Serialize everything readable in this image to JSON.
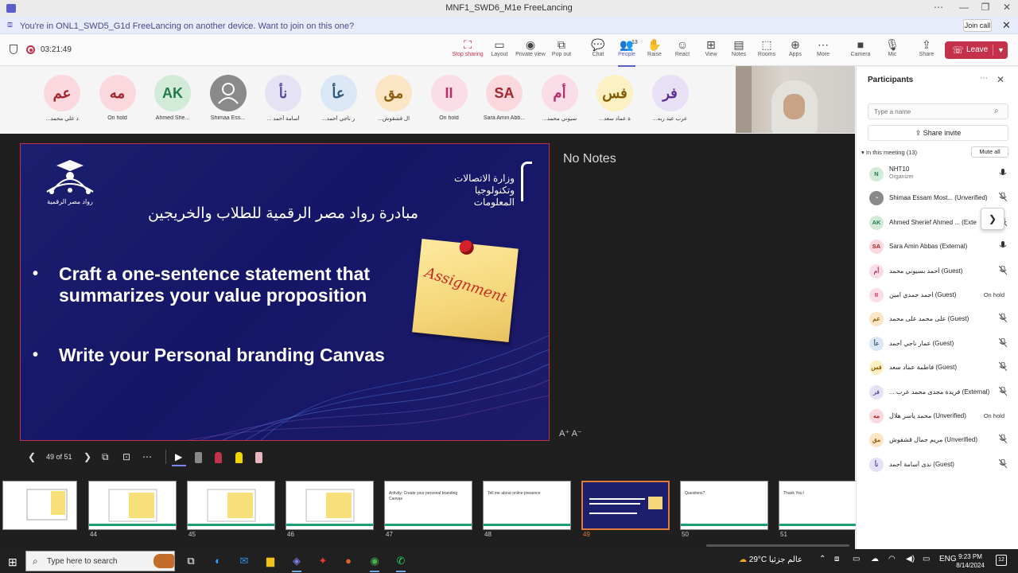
{
  "window": {
    "title": "MNF1_SWD6_M1e FreeLancing",
    "controls": [
      "⋯",
      "—",
      "❐",
      "✕"
    ]
  },
  "banner": {
    "message": "You're in ONL1_SWD5_G1d FreeLancing on another device. Want to join on this one?",
    "join_label": "Join call"
  },
  "toolbar": {
    "timer": "03:21:49",
    "buttons": [
      {
        "label": "Stop sharing",
        "icon": "stop-share-icon",
        "glyph": "⛶"
      },
      {
        "label": "Layout",
        "icon": "layout-icon",
        "glyph": "▭"
      },
      {
        "label": "Private view",
        "icon": "eye-icon",
        "glyph": "◉"
      },
      {
        "label": "Pop out",
        "icon": "pop-out-icon",
        "glyph": "⧉"
      },
      {
        "label": "Chat",
        "icon": "chat-icon",
        "glyph": "💬"
      },
      {
        "label": "People",
        "icon": "people-icon",
        "glyph": "👥",
        "badge": "13"
      },
      {
        "label": "Raise",
        "icon": "raise-hand-icon",
        "glyph": "✋"
      },
      {
        "label": "React",
        "icon": "react-icon",
        "glyph": "☺"
      },
      {
        "label": "View",
        "icon": "view-icon",
        "glyph": "⊞"
      },
      {
        "label": "Notes",
        "icon": "notes-icon",
        "glyph": "▤"
      },
      {
        "label": "Rooms",
        "icon": "rooms-icon",
        "glyph": "⬚"
      },
      {
        "label": "Apps",
        "icon": "apps-icon",
        "glyph": "⊕"
      },
      {
        "label": "More",
        "icon": "more-icon",
        "glyph": "⋯"
      },
      {
        "label": "Camera",
        "icon": "camera-icon",
        "glyph": "■"
      },
      {
        "label": "Mic",
        "icon": "mic-icon",
        "glyph": "🎙"
      },
      {
        "label": "Share",
        "icon": "share-icon",
        "glyph": "⇪"
      }
    ],
    "leave_label": "Leave"
  },
  "avatars": [
    {
      "initials": "عم",
      "name": "...د علي محمد",
      "color": "pink"
    },
    {
      "initials": "مه",
      "name": "On hold",
      "color": "pink"
    },
    {
      "initials": "AK",
      "name": "Ahmed She...",
      "color": "green"
    },
    {
      "initials": "",
      "name": "Shimaa Ess...",
      "color": "gray"
    },
    {
      "initials": "نأ",
      "name": "... أسامة أحمد",
      "color": "lav"
    },
    {
      "initials": "عأ",
      "name": "...ر ناجي أحمد",
      "color": "blue"
    },
    {
      "initials": "مق",
      "name": "...ال قشقوش",
      "color": "peach"
    },
    {
      "initials": "II",
      "name": "On hold",
      "color": "rose"
    },
    {
      "initials": "SA",
      "name": "Sara Amin Abb...",
      "color": "pink"
    },
    {
      "initials": "أم",
      "name": "...سيوني محمد",
      "color": "rose"
    },
    {
      "initials": "فس",
      "name": "...ة عماد سعد",
      "color": "yel"
    },
    {
      "initials": "فر",
      "name": "...عرب عبد ربه",
      "color": "purple"
    }
  ],
  "slide": {
    "ministry_logo": "وزارة الاتصالات وتكنولوجيا المعلومات",
    "initiative_logo": "رواد مصر الرقمية",
    "arabic_title": "مبادرة رواد مصر الرقمية للطلاب والخريجين",
    "bullets": [
      "Craft a one-sentence statement that summarizes your value proposition",
      "Write your Personal branding Canvas"
    ],
    "note_word": "Assignment"
  },
  "notes": {
    "heading": "No Notes",
    "font_controls": "A⁺  A⁻"
  },
  "slide_nav": {
    "counter": "49 of 51"
  },
  "thumbnails": [
    {
      "num": "44",
      "current": false,
      "label": ""
    },
    {
      "num": "45",
      "current": false,
      "label": ""
    },
    {
      "num": "46",
      "current": false,
      "label": ""
    },
    {
      "num": "47",
      "current": false,
      "label": "Activity: Create your personal branding Canvas"
    },
    {
      "num": "48",
      "current": false,
      "label": "Tell me about online presence"
    },
    {
      "num": "49",
      "current": true,
      "label": ""
    },
    {
      "num": "50",
      "current": false,
      "label": "Questions?"
    },
    {
      "num": "51",
      "current": false,
      "label": "Thank You !"
    }
  ],
  "participants": {
    "title": "Participants",
    "search_placeholder": "Type a name",
    "share_invite": "Share invite",
    "in_meeting": "In this meeting (13)",
    "mute_all": "Mute all",
    "list": [
      {
        "initials": "N",
        "name": "NHT10",
        "role": "Organizer",
        "status": "",
        "color": "green",
        "muted": false
      },
      {
        "initials": "",
        "name": "Shimaa Essam Most... (Unverified)",
        "role": "",
        "status": "",
        "color": "gray",
        "muted": true
      },
      {
        "initials": "AK",
        "name": "Ahmed Sherief Ahmed ... (Exte",
        "role": "",
        "status": "",
        "color": "green",
        "muted": true
      },
      {
        "initials": "SA",
        "name": "Sara Amin Abbas (External)",
        "role": "",
        "status": "",
        "color": "pink",
        "muted": false
      },
      {
        "initials": "أم",
        "name": "أحمد بسيوني محمد (Guest)",
        "role": "",
        "status": "",
        "color": "rose",
        "muted": true
      },
      {
        "initials": "II",
        "name": "احمد حمدي امين (Guest)",
        "role": "",
        "status": "On hold",
        "color": "rose",
        "muted": false
      },
      {
        "initials": "عم",
        "name": "على محمد على محمد (Guest)",
        "role": "",
        "status": "",
        "color": "peach",
        "muted": true
      },
      {
        "initials": "عأ",
        "name": "عمار ناجي أحمد (Guest)",
        "role": "",
        "status": "",
        "color": "blue",
        "muted": true
      },
      {
        "initials": "فس",
        "name": "فاطمة عماد سعد (Guest)",
        "role": "",
        "status": "",
        "color": "yel",
        "muted": true
      },
      {
        "initials": "فر",
        "name": "... فريدة مجدى محمد عرب (External)",
        "role": "",
        "status": "",
        "color": "lav",
        "muted": true
      },
      {
        "initials": "مه",
        "name": "محمد ياسر هلال (Unverified)",
        "role": "",
        "status": "On hold",
        "color": "pink",
        "muted": false
      },
      {
        "initials": "مق",
        "name": "مريم جمال قشقوش (Unverified)",
        "role": "",
        "status": "",
        "color": "peach",
        "muted": true
      },
      {
        "initials": "نأ",
        "name": "ندى أسامة أحمد (Guest)",
        "role": "",
        "status": "",
        "color": "pl",
        "muted": true
      }
    ]
  },
  "taskbar": {
    "search_text": "Type here to search",
    "weather": "29°C عالم جزئيا",
    "lang": "ENG",
    "time": "9:23 PM",
    "date": "8/14/2024",
    "notifications": "12"
  },
  "colors": {
    "accent": "#5b5fc7",
    "leave": "#c4314b",
    "slide_bg": "#1c1e6e",
    "current_thumb": "#e07b3a"
  }
}
